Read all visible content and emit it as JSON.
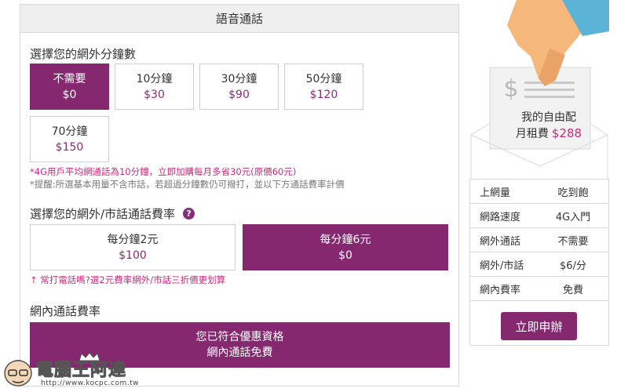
{
  "panel": {
    "title": "語音通話"
  },
  "minutes": {
    "title": "選擇您的網外分鐘數",
    "options": [
      {
        "label": "不需要",
        "price": "$0",
        "selected": true
      },
      {
        "label": "10分鐘",
        "price": "$30"
      },
      {
        "label": "30分鐘",
        "price": "$90"
      },
      {
        "label": "50分鐘",
        "price": "$120"
      },
      {
        "label": "70分鐘",
        "price": "$150"
      }
    ],
    "note_pink": "*4G用戶平均網通話為10分鐘，立即加購每月多省30元(原價60元)",
    "note_grey": "*提醒:所選基本用量不含市話，若超過分鐘數仍可撥打，並以下方通話費率計價"
  },
  "rate": {
    "title": "選擇您的網外/市話通話費率",
    "help_icon": "?",
    "options": [
      {
        "label": "每分鐘2元",
        "price": "$100"
      },
      {
        "label": "每分鐘6元",
        "price": "$0",
        "selected": true
      }
    ],
    "note": "↑ 常打電話嗎?選2元費率網外/市話三折價更划算"
  },
  "inner_rate": {
    "title": "網內通話費率",
    "line1": "您已符合優惠資格",
    "line2": "網內通話免費"
  },
  "summary": {
    "receipt_title": "我的自由配",
    "receipt_fee_label": "月租費",
    "receipt_fee_value": "$288",
    "dollar_icon": "$",
    "rows": [
      {
        "k": "上網量",
        "v": "吃到飽"
      },
      {
        "k": "網路速度",
        "v": "4G入門"
      },
      {
        "k": "網外通話",
        "v": "不需要"
      },
      {
        "k": "網外/市話",
        "v": "$6/分"
      },
      {
        "k": "網內費率",
        "v": "免費"
      }
    ],
    "apply_label": "立即申辦"
  },
  "watermark": {
    "title": "電腦王阿達",
    "url": "http://www.kocpc.com.tw"
  },
  "colors": {
    "accent": "#85286f",
    "pink": "#d0287a"
  }
}
